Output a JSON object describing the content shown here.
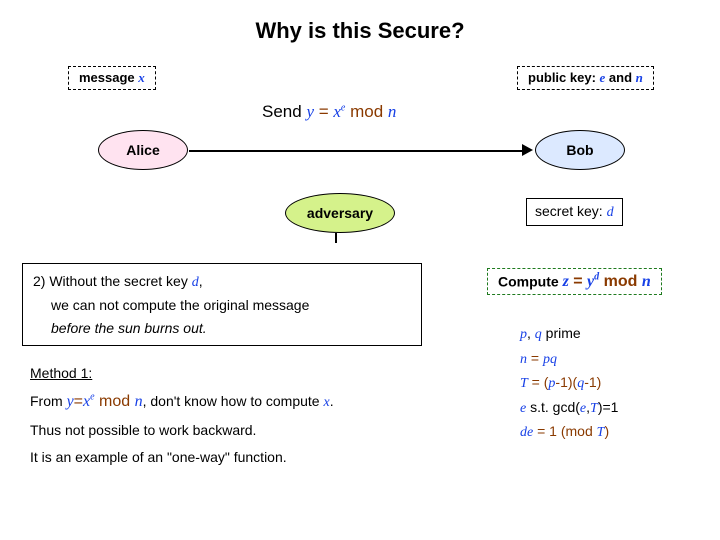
{
  "title": "Why is this Secure?",
  "boxes": {
    "message_prefix": "message ",
    "message_var": "x",
    "pubkey_prefix": "public key: ",
    "pubkey_e": "e",
    "pubkey_and": " and ",
    "pubkey_n": "n",
    "secretkey_prefix": "secret key: ",
    "secretkey_d": "d"
  },
  "parties": {
    "alice": "Alice",
    "bob": "Bob",
    "adversary": "adversary"
  },
  "send": {
    "label": "Send ",
    "eq1": "y",
    "eq2": " = ",
    "eq3": "x",
    "exp": "e",
    "eq4": " mod ",
    "n": "n"
  },
  "note2": {
    "l1a": "2) Without the secret key ",
    "l1d": "d",
    "l1b": ",",
    "l2": "we can not compute the original message",
    "l3": "before the sun burns out."
  },
  "method1": {
    "heading": "Method 1:",
    "line1a": "From ",
    "y": "y",
    "eqop": "=",
    "x": "x",
    "e": "e",
    "mod": " mod ",
    "n": "n",
    "line1b": ", don't know how to compute ",
    "xx": "x",
    "line1c": ".",
    "line2": "Thus not possible to work backward.",
    "line3": "It is an example of an \"one-way\" function."
  },
  "compute": {
    "prefix": "Compute ",
    "z": "z",
    "eqop": " = ",
    "y": "y",
    "d": "d",
    "mod": " mod ",
    "n": "n"
  },
  "maths": {
    "l1a": "p",
    "l1b": ", ",
    "l1c": "q",
    "l1d": " prime",
    "l2a": "n",
    "l2b": " = ",
    "l2c": "pq",
    "l3a": "T",
    "l3b": " = (",
    "l3c": "p",
    "l3d": "-1)(",
    "l3e": "q",
    "l3f": "-1)",
    "l4a": "e",
    "l4b": " s.t. gcd(",
    "l4c": "e",
    "l4d": ",",
    "l4e": "T",
    "l4f": ")=1",
    "l5a": "de",
    "l5b": " = 1 (mod ",
    "l5c": "T",
    "l5d": ")"
  }
}
